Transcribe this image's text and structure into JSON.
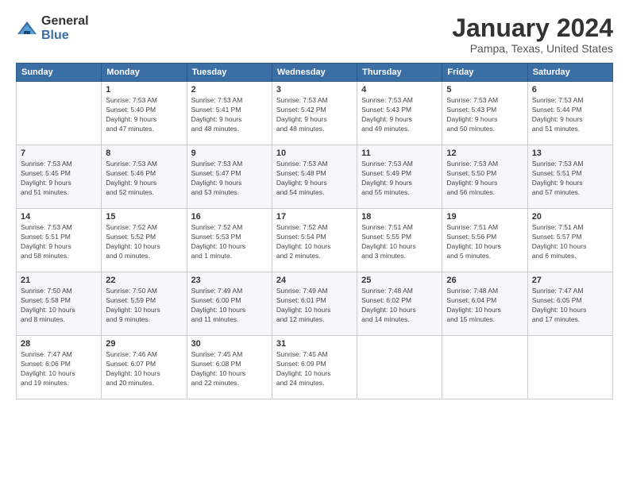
{
  "header": {
    "logo_general": "General",
    "logo_blue": "Blue",
    "title": "January 2024",
    "subtitle": "Pampa, Texas, United States"
  },
  "weekdays": [
    "Sunday",
    "Monday",
    "Tuesday",
    "Wednesday",
    "Thursday",
    "Friday",
    "Saturday"
  ],
  "weeks": [
    [
      {
        "day": "",
        "info": ""
      },
      {
        "day": "1",
        "info": "Sunrise: 7:53 AM\nSunset: 5:40 PM\nDaylight: 9 hours\nand 47 minutes."
      },
      {
        "day": "2",
        "info": "Sunrise: 7:53 AM\nSunset: 5:41 PM\nDaylight: 9 hours\nand 48 minutes."
      },
      {
        "day": "3",
        "info": "Sunrise: 7:53 AM\nSunset: 5:42 PM\nDaylight: 9 hours\nand 48 minutes."
      },
      {
        "day": "4",
        "info": "Sunrise: 7:53 AM\nSunset: 5:43 PM\nDaylight: 9 hours\nand 49 minutes."
      },
      {
        "day": "5",
        "info": "Sunrise: 7:53 AM\nSunset: 5:43 PM\nDaylight: 9 hours\nand 50 minutes."
      },
      {
        "day": "6",
        "info": "Sunrise: 7:53 AM\nSunset: 5:44 PM\nDaylight: 9 hours\nand 51 minutes."
      }
    ],
    [
      {
        "day": "7",
        "info": "Sunrise: 7:53 AM\nSunset: 5:45 PM\nDaylight: 9 hours\nand 51 minutes."
      },
      {
        "day": "8",
        "info": "Sunrise: 7:53 AM\nSunset: 5:46 PM\nDaylight: 9 hours\nand 52 minutes."
      },
      {
        "day": "9",
        "info": "Sunrise: 7:53 AM\nSunset: 5:47 PM\nDaylight: 9 hours\nand 53 minutes."
      },
      {
        "day": "10",
        "info": "Sunrise: 7:53 AM\nSunset: 5:48 PM\nDaylight: 9 hours\nand 54 minutes."
      },
      {
        "day": "11",
        "info": "Sunrise: 7:53 AM\nSunset: 5:49 PM\nDaylight: 9 hours\nand 55 minutes."
      },
      {
        "day": "12",
        "info": "Sunrise: 7:53 AM\nSunset: 5:50 PM\nDaylight: 9 hours\nand 56 minutes."
      },
      {
        "day": "13",
        "info": "Sunrise: 7:53 AM\nSunset: 5:51 PM\nDaylight: 9 hours\nand 57 minutes."
      }
    ],
    [
      {
        "day": "14",
        "info": "Sunrise: 7:53 AM\nSunset: 5:51 PM\nDaylight: 9 hours\nand 58 minutes."
      },
      {
        "day": "15",
        "info": "Sunrise: 7:52 AM\nSunset: 5:52 PM\nDaylight: 10 hours\nand 0 minutes."
      },
      {
        "day": "16",
        "info": "Sunrise: 7:52 AM\nSunset: 5:53 PM\nDaylight: 10 hours\nand 1 minute."
      },
      {
        "day": "17",
        "info": "Sunrise: 7:52 AM\nSunset: 5:54 PM\nDaylight: 10 hours\nand 2 minutes."
      },
      {
        "day": "18",
        "info": "Sunrise: 7:51 AM\nSunset: 5:55 PM\nDaylight: 10 hours\nand 3 minutes."
      },
      {
        "day": "19",
        "info": "Sunrise: 7:51 AM\nSunset: 5:56 PM\nDaylight: 10 hours\nand 5 minutes."
      },
      {
        "day": "20",
        "info": "Sunrise: 7:51 AM\nSunset: 5:57 PM\nDaylight: 10 hours\nand 6 minutes."
      }
    ],
    [
      {
        "day": "21",
        "info": "Sunrise: 7:50 AM\nSunset: 5:58 PM\nDaylight: 10 hours\nand 8 minutes."
      },
      {
        "day": "22",
        "info": "Sunrise: 7:50 AM\nSunset: 5:59 PM\nDaylight: 10 hours\nand 9 minutes."
      },
      {
        "day": "23",
        "info": "Sunrise: 7:49 AM\nSunset: 6:00 PM\nDaylight: 10 hours\nand 11 minutes."
      },
      {
        "day": "24",
        "info": "Sunrise: 7:49 AM\nSunset: 6:01 PM\nDaylight: 10 hours\nand 12 minutes."
      },
      {
        "day": "25",
        "info": "Sunrise: 7:48 AM\nSunset: 6:02 PM\nDaylight: 10 hours\nand 14 minutes."
      },
      {
        "day": "26",
        "info": "Sunrise: 7:48 AM\nSunset: 6:04 PM\nDaylight: 10 hours\nand 15 minutes."
      },
      {
        "day": "27",
        "info": "Sunrise: 7:47 AM\nSunset: 6:05 PM\nDaylight: 10 hours\nand 17 minutes."
      }
    ],
    [
      {
        "day": "28",
        "info": "Sunrise: 7:47 AM\nSunset: 6:06 PM\nDaylight: 10 hours\nand 19 minutes."
      },
      {
        "day": "29",
        "info": "Sunrise: 7:46 AM\nSunset: 6:07 PM\nDaylight: 10 hours\nand 20 minutes."
      },
      {
        "day": "30",
        "info": "Sunrise: 7:45 AM\nSunset: 6:08 PM\nDaylight: 10 hours\nand 22 minutes."
      },
      {
        "day": "31",
        "info": "Sunrise: 7:45 AM\nSunset: 6:09 PM\nDaylight: 10 hours\nand 24 minutes."
      },
      {
        "day": "",
        "info": ""
      },
      {
        "day": "",
        "info": ""
      },
      {
        "day": "",
        "info": ""
      }
    ]
  ]
}
